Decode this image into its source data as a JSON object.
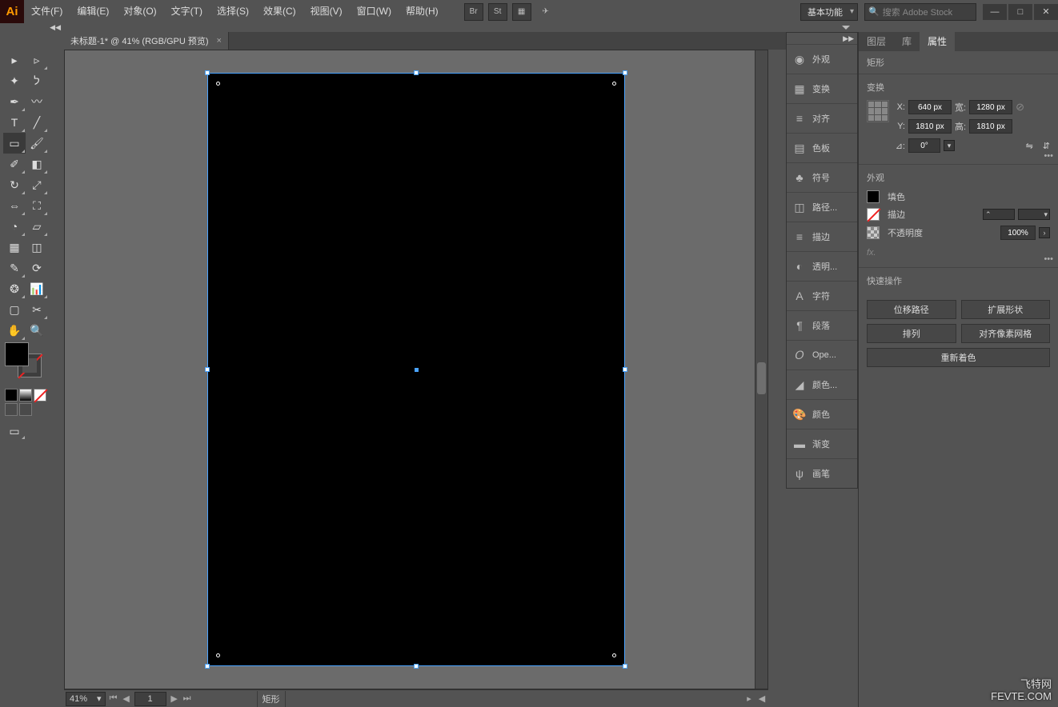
{
  "menubar": {
    "items": [
      "文件(F)",
      "编辑(E)",
      "对象(O)",
      "文字(T)",
      "选择(S)",
      "效果(C)",
      "视图(V)",
      "窗口(W)",
      "帮助(H)"
    ],
    "logo": "Ai",
    "icon_br": "Br",
    "icon_st": "St",
    "workspace": "基本功能",
    "search_placeholder": "搜索 Adobe Stock"
  },
  "doc_tab": {
    "title": "未标题-1* @ 41% (RGB/GPU 预览)"
  },
  "statusbar": {
    "zoom": "41%",
    "page": "1",
    "selection": "矩形"
  },
  "panel_strip": {
    "items": [
      "外观",
      "变换",
      "对齐",
      "色板",
      "符号",
      "路径...",
      "描边",
      "透明...",
      "字符",
      "段落",
      "Ope...",
      "颜色...",
      "颜色",
      "渐变",
      "画笔"
    ]
  },
  "properties": {
    "tabs": [
      "图层",
      "库",
      "属性"
    ],
    "object_type": "矩形",
    "transform": {
      "label": "变换",
      "x_lbl": "X:",
      "x": "640 px",
      "w_lbl": "宽:",
      "w": "1280 px",
      "y_lbl": "Y:",
      "y": "1810 px",
      "h_lbl": "高:",
      "h": "1810 px",
      "angle_lbl": "⊿:",
      "angle": "0°"
    },
    "appearance": {
      "label": "外观",
      "fill_label": "填色",
      "stroke_label": "描边",
      "opacity_label": "不透明度",
      "opacity_value": "100%",
      "fx": "fx."
    },
    "quick": {
      "label": "快速操作",
      "offset": "位移路径",
      "expand": "扩展形状",
      "arrange": "排列",
      "align": "对齐像素网格",
      "recolor": "重新着色"
    }
  },
  "watermark": {
    "line1": "飞特网",
    "line2": "FEVTE.COM"
  }
}
